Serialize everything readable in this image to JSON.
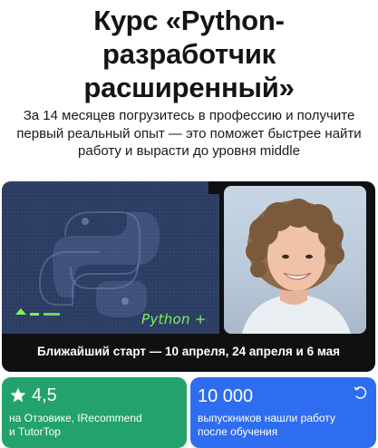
{
  "header": {
    "title_line1": "Курс «Python-",
    "title_line2": "разработчик",
    "title_line3": "расширенный»",
    "subtitle_line1": "За 14 месяцев погрузитесь в профессию и получите",
    "subtitle_line2": "первый реальный опыт — это поможет быстрее найти",
    "subtitle_line3": "работу и вырасти до уровня middle"
  },
  "hero": {
    "logo_text": "Python +",
    "start_text": "Ближайший старт — 10 апреля, 24 апреля и 6 мая"
  },
  "rating_card": {
    "icon": "star-icon",
    "value": "4,5",
    "line1": "на Отзовике, IRecommend",
    "line2": "и TutorTop",
    "color": "#23a26d"
  },
  "graduates_card": {
    "icon": "redo-arrow-icon",
    "value": "10 000",
    "line1": "выпускников нашли работу",
    "line2": "после обучения",
    "color": "#2f6df0"
  }
}
